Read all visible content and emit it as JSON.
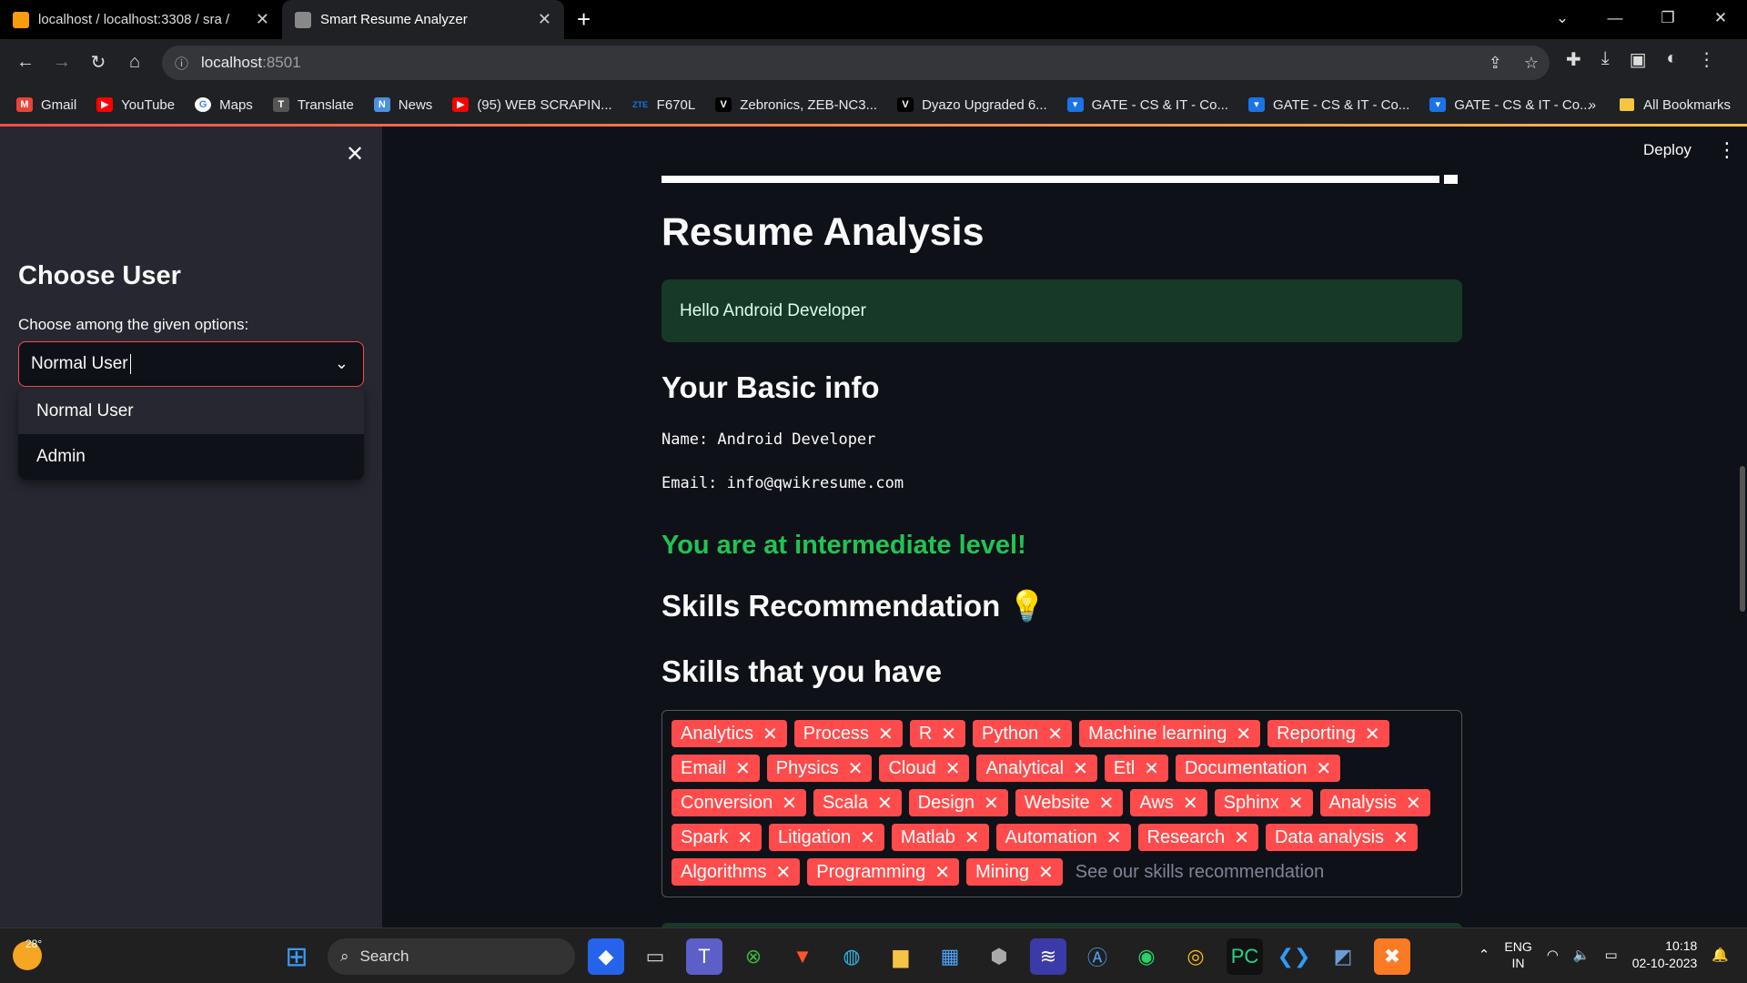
{
  "browser": {
    "tabs": [
      {
        "title": "localhost / localhost:3308 / sra /",
        "active": false
      },
      {
        "title": "Smart Resume Analyzer",
        "active": true
      }
    ],
    "url_host": "localhost",
    "url_port": ":8501",
    "bookmarks": [
      {
        "label": "Gmail",
        "icon": "gmail-icon",
        "color": "#ea4335"
      },
      {
        "label": "YouTube",
        "icon": "youtube-icon",
        "color": "#ff0000"
      },
      {
        "label": "Maps",
        "icon": "google-icon",
        "color": "#4285f4"
      },
      {
        "label": "Translate",
        "icon": "translate-icon",
        "color": "#666666"
      },
      {
        "label": "News",
        "icon": "news-icon",
        "color": "#4a90e2"
      },
      {
        "label": "(95) WEB SCRAPIN...",
        "icon": "youtube-icon",
        "color": "#ff0000"
      },
      {
        "label": "F670L",
        "icon": "zte-icon",
        "color": "#1a73e8"
      },
      {
        "label": "Zebronics, ZEB-NC3...",
        "icon": "v-icon",
        "color": "#000000"
      },
      {
        "label": "Dyazo Upgraded 6...",
        "icon": "v-icon",
        "color": "#000000"
      },
      {
        "label": "GATE - CS & IT - Co...",
        "icon": "gate-icon",
        "color": "#1a73e8"
      },
      {
        "label": "GATE - CS & IT - Co...",
        "icon": "gate-icon",
        "color": "#1a73e8"
      },
      {
        "label": "GATE - CS & IT - Co...",
        "icon": "gate-icon",
        "color": "#1a73e8"
      }
    ],
    "all_bookmarks": "All Bookmarks",
    "more_bookmarks": "»"
  },
  "app": {
    "deploy_label": "Deploy",
    "sidebar": {
      "title": "Choose User",
      "select_label": "Choose among the given options:",
      "select_value": "Normal User",
      "options": [
        "Normal User",
        "Admin"
      ]
    },
    "main": {
      "title": "Resume Analysis",
      "greeting": "Hello Android Developer",
      "basic_info_heading": "Your Basic info",
      "name_line": "Name: Android Developer",
      "email_line": "Email: info@qwikresume.com",
      "level": "You are at intermediate level!",
      "skills_reco_heading": "Skills Recommendation 💡",
      "skills_have_heading": "Skills that you have",
      "skills": [
        "Analytics",
        "Process",
        "R",
        "Python",
        "Machine learning",
        "Reporting",
        "Email",
        "Physics",
        "Cloud",
        "Analytical",
        "Etl",
        "Documentation",
        "Conversion",
        "Scala",
        "Design",
        "Website",
        "Aws",
        "Sphinx",
        "Analysis",
        "Spark",
        "Litigation",
        "Matlab",
        "Automation",
        "Research",
        "Data analysis",
        "Algorithms",
        "Programming",
        "Mining"
      ],
      "skills_placeholder": "See our skills recommendation"
    }
  },
  "taskbar": {
    "temperature": "28°",
    "search_label": "Search",
    "lang_line1": "ENG",
    "lang_line2": "IN",
    "time": "10:18",
    "date": "02-10-2023"
  }
}
